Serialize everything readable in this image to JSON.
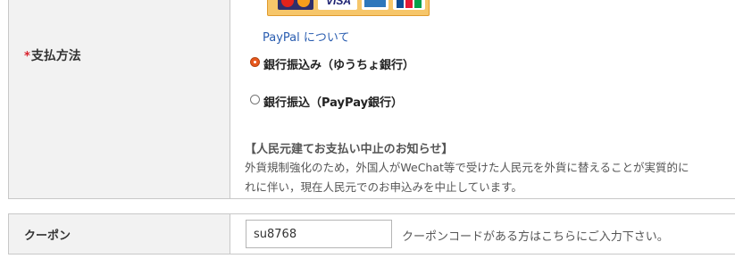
{
  "payment_section": {
    "label": "支払方法",
    "required_mark": "*",
    "card_logos": [
      "mastercard-logo",
      "visa-logo",
      "amex-logo",
      "jcb-logo"
    ],
    "visa_text": "VISA",
    "paypal_link": "PayPal について",
    "options": [
      {
        "label": "銀行振込み（ゆうちょ銀行）",
        "selected": true
      },
      {
        "label": "銀行振込（PayPay銀行）",
        "selected": false
      }
    ],
    "notice": {
      "title": "【人民元建てお支払い中止のお知らせ】",
      "lines": [
        "外貨規制強化のため，外国人がWeChat等で受けた人民元を外貨に替えることが実質的に",
        "れに伴い，現在人民元でのお申込みを中止しています。"
      ]
    }
  },
  "coupon_section": {
    "label": "クーポン",
    "input_value": "su8768",
    "hint": "クーポンコードがある方はこちらにご入力下さい。"
  },
  "colors": {
    "required": "#d9212c",
    "link": "#2a5db0",
    "radio_selected": "#e8581e",
    "label_bg": "#f2f2f2"
  }
}
